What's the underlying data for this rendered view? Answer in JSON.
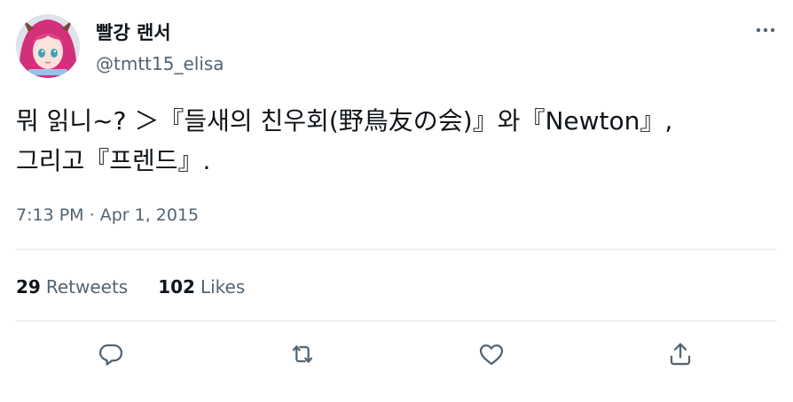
{
  "user": {
    "display_name": "빨강 랜서",
    "handle": "@tmtt15_elisa"
  },
  "tweet": {
    "text": "뭐 읽니~? ＞『들새의 친우회(野鳥友の会)』와『Newton』,\n그리고『프렌드』.",
    "timestamp": "7:13 PM",
    "separator": "·",
    "date": "Apr 1, 2015"
  },
  "stats": {
    "retweets_count": "29",
    "retweets_label": "Retweets",
    "likes_count": "102",
    "likes_label": "Likes"
  },
  "icons": {
    "more": "more-horizontal-icon",
    "reply": "reply-icon",
    "retweet": "retweet-icon",
    "like": "heart-icon",
    "share": "share-icon"
  },
  "colors": {
    "text": "#0f1419",
    "secondary": "#536471",
    "divider": "#e1e5e8"
  }
}
